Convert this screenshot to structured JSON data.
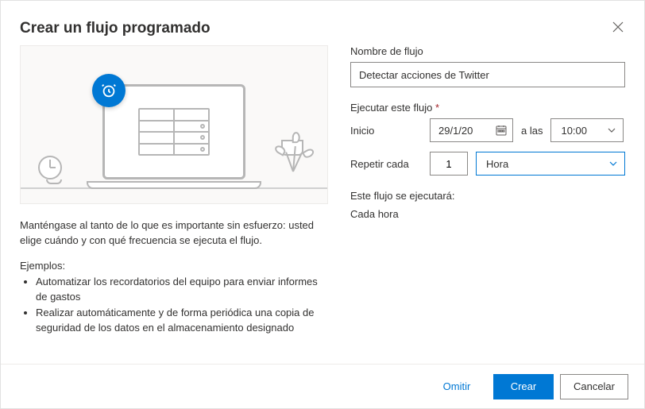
{
  "header": {
    "title": "Crear un flujo programado"
  },
  "left": {
    "description": "Manténgase al tanto de lo que es importante sin esfuerzo: usted elige cuándo y con qué frecuencia se ejecuta el flujo.",
    "examples_label": "Ejemplos:",
    "examples": [
      "Automatizar los recordatorios del equipo para enviar informes de gastos",
      "Realizar automáticamente y de forma periódica una copia de seguridad de los datos en el almacenamiento designado"
    ]
  },
  "form": {
    "flow_name_label": "Nombre de flujo",
    "flow_name_value": "Detectar acciones de Twitter",
    "run_section_label": "Ejecutar este flujo",
    "required_marker": "*",
    "start_label": "Inicio",
    "start_date": "29/1/20",
    "at_label": "a las",
    "start_time": "10:00",
    "repeat_label": "Repetir cada",
    "repeat_value": "1",
    "repeat_unit": "Hora",
    "summary_label": "Este flujo se ejecutará:",
    "summary_value": "Cada hora"
  },
  "footer": {
    "skip": "Omitir",
    "create": "Crear",
    "cancel": "Cancelar"
  }
}
